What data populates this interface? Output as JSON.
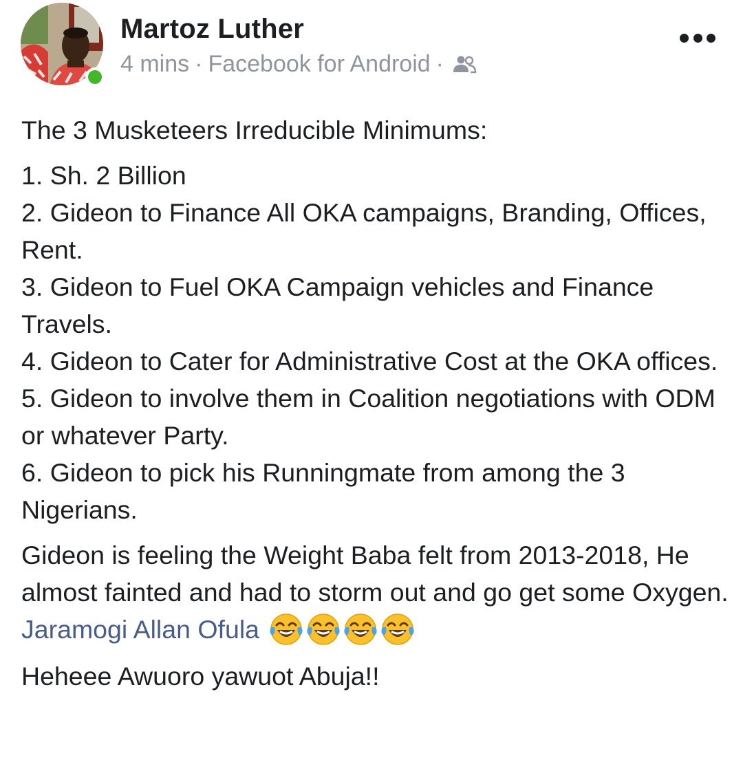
{
  "post": {
    "author": {
      "name": "Martoz Luther",
      "online": true
    },
    "meta": {
      "time": "4 mins",
      "source": "Facebook for Android",
      "separator": "·",
      "privacy_icon": "friends-icon"
    },
    "body": {
      "title": "The 3 Musketeers Irreducible Minimums:",
      "list": [
        "1. Sh. 2 Billion",
        "2. Gideon to Finance All OKA campaigns, Branding, Offices, Rent.",
        "3. Gideon to Fuel OKA Campaign vehicles and Finance Travels.",
        "4. Gideon to Cater for Administrative Cost at the OKA offices.",
        "5. Gideon to involve them in Coalition negotiations with ODM or whatever Party.",
        "6. Gideon to pick his Runningmate from among the 3 Nigerians."
      ],
      "paragraph": "Gideon is feeling the Weight Baba felt from 2013-2018, He almost fainted and had to storm out and go get some Oxygen.",
      "mention": "Jaramogi Allan Ofula",
      "emojis": [
        "face-with-tears-of-joy-icon",
        "face-with-tears-of-joy-icon",
        "face-with-tears-of-joy-icon",
        "face-with-tears-of-joy-icon"
      ],
      "closing": "Heheee Awuoro yawuot Abuja!!"
    }
  },
  "colors": {
    "text": "#1c1e21",
    "meta": "#90949c",
    "mention": "#485d8a",
    "online": "#42b72a"
  }
}
